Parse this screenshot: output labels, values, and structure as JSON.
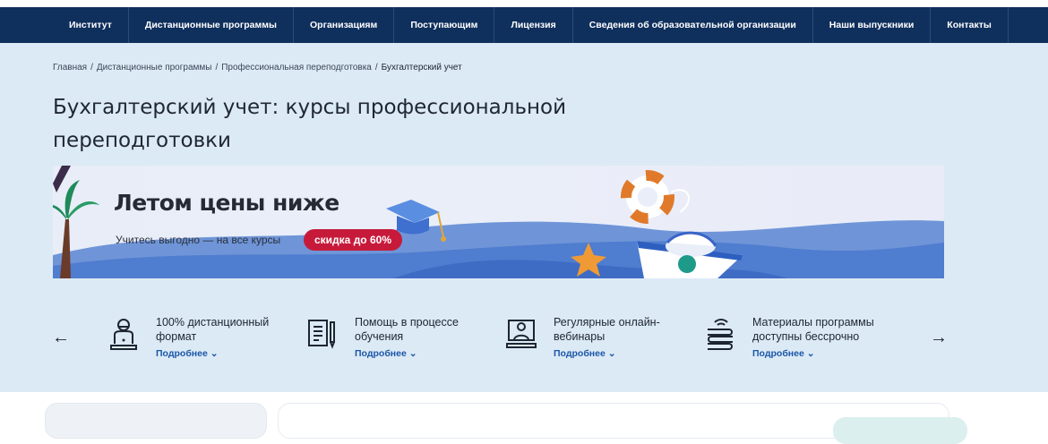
{
  "nav": {
    "items": [
      "Институт",
      "Дистанционные программы",
      "Организациям",
      "Поступающим",
      "Лицензия",
      "Сведения об образовательной организации",
      "Наши выпускники",
      "Контакты"
    ]
  },
  "breadcrumb": {
    "items": [
      "Главная",
      "Дистанционные программы",
      "Профессиональная переподготовка",
      "Бухгалтерский учет"
    ],
    "separator": "/"
  },
  "page": {
    "title": "Бухгалтерский учет: курсы профессиональной переподготовки"
  },
  "banner": {
    "title": "Летом цены ниже",
    "subtitle": "Учитесь выгодно — на все курсы",
    "badge": "скидка до 60%"
  },
  "features": {
    "items": [
      {
        "icon": "remote-user-icon",
        "text": "100% дистанционный формат",
        "more": "Подробнее"
      },
      {
        "icon": "document-pen-icon",
        "text": "Помощь в процессе обучения",
        "more": "Подробнее"
      },
      {
        "icon": "webinar-teacher-icon",
        "text": "Регулярные онлайн-вебинары",
        "more": "Подробнее"
      },
      {
        "icon": "materials-stack-icon",
        "text": "Материалы программы доступны бессрочно",
        "more": "Подробнее"
      }
    ],
    "prev_arrow": "←",
    "next_arrow": "→"
  },
  "colors": {
    "nav_bg": "#0f2f5c",
    "hero_bg": "#dceaf5",
    "accent_link": "#1a56a8",
    "badge_bg": "#c71a3a"
  }
}
